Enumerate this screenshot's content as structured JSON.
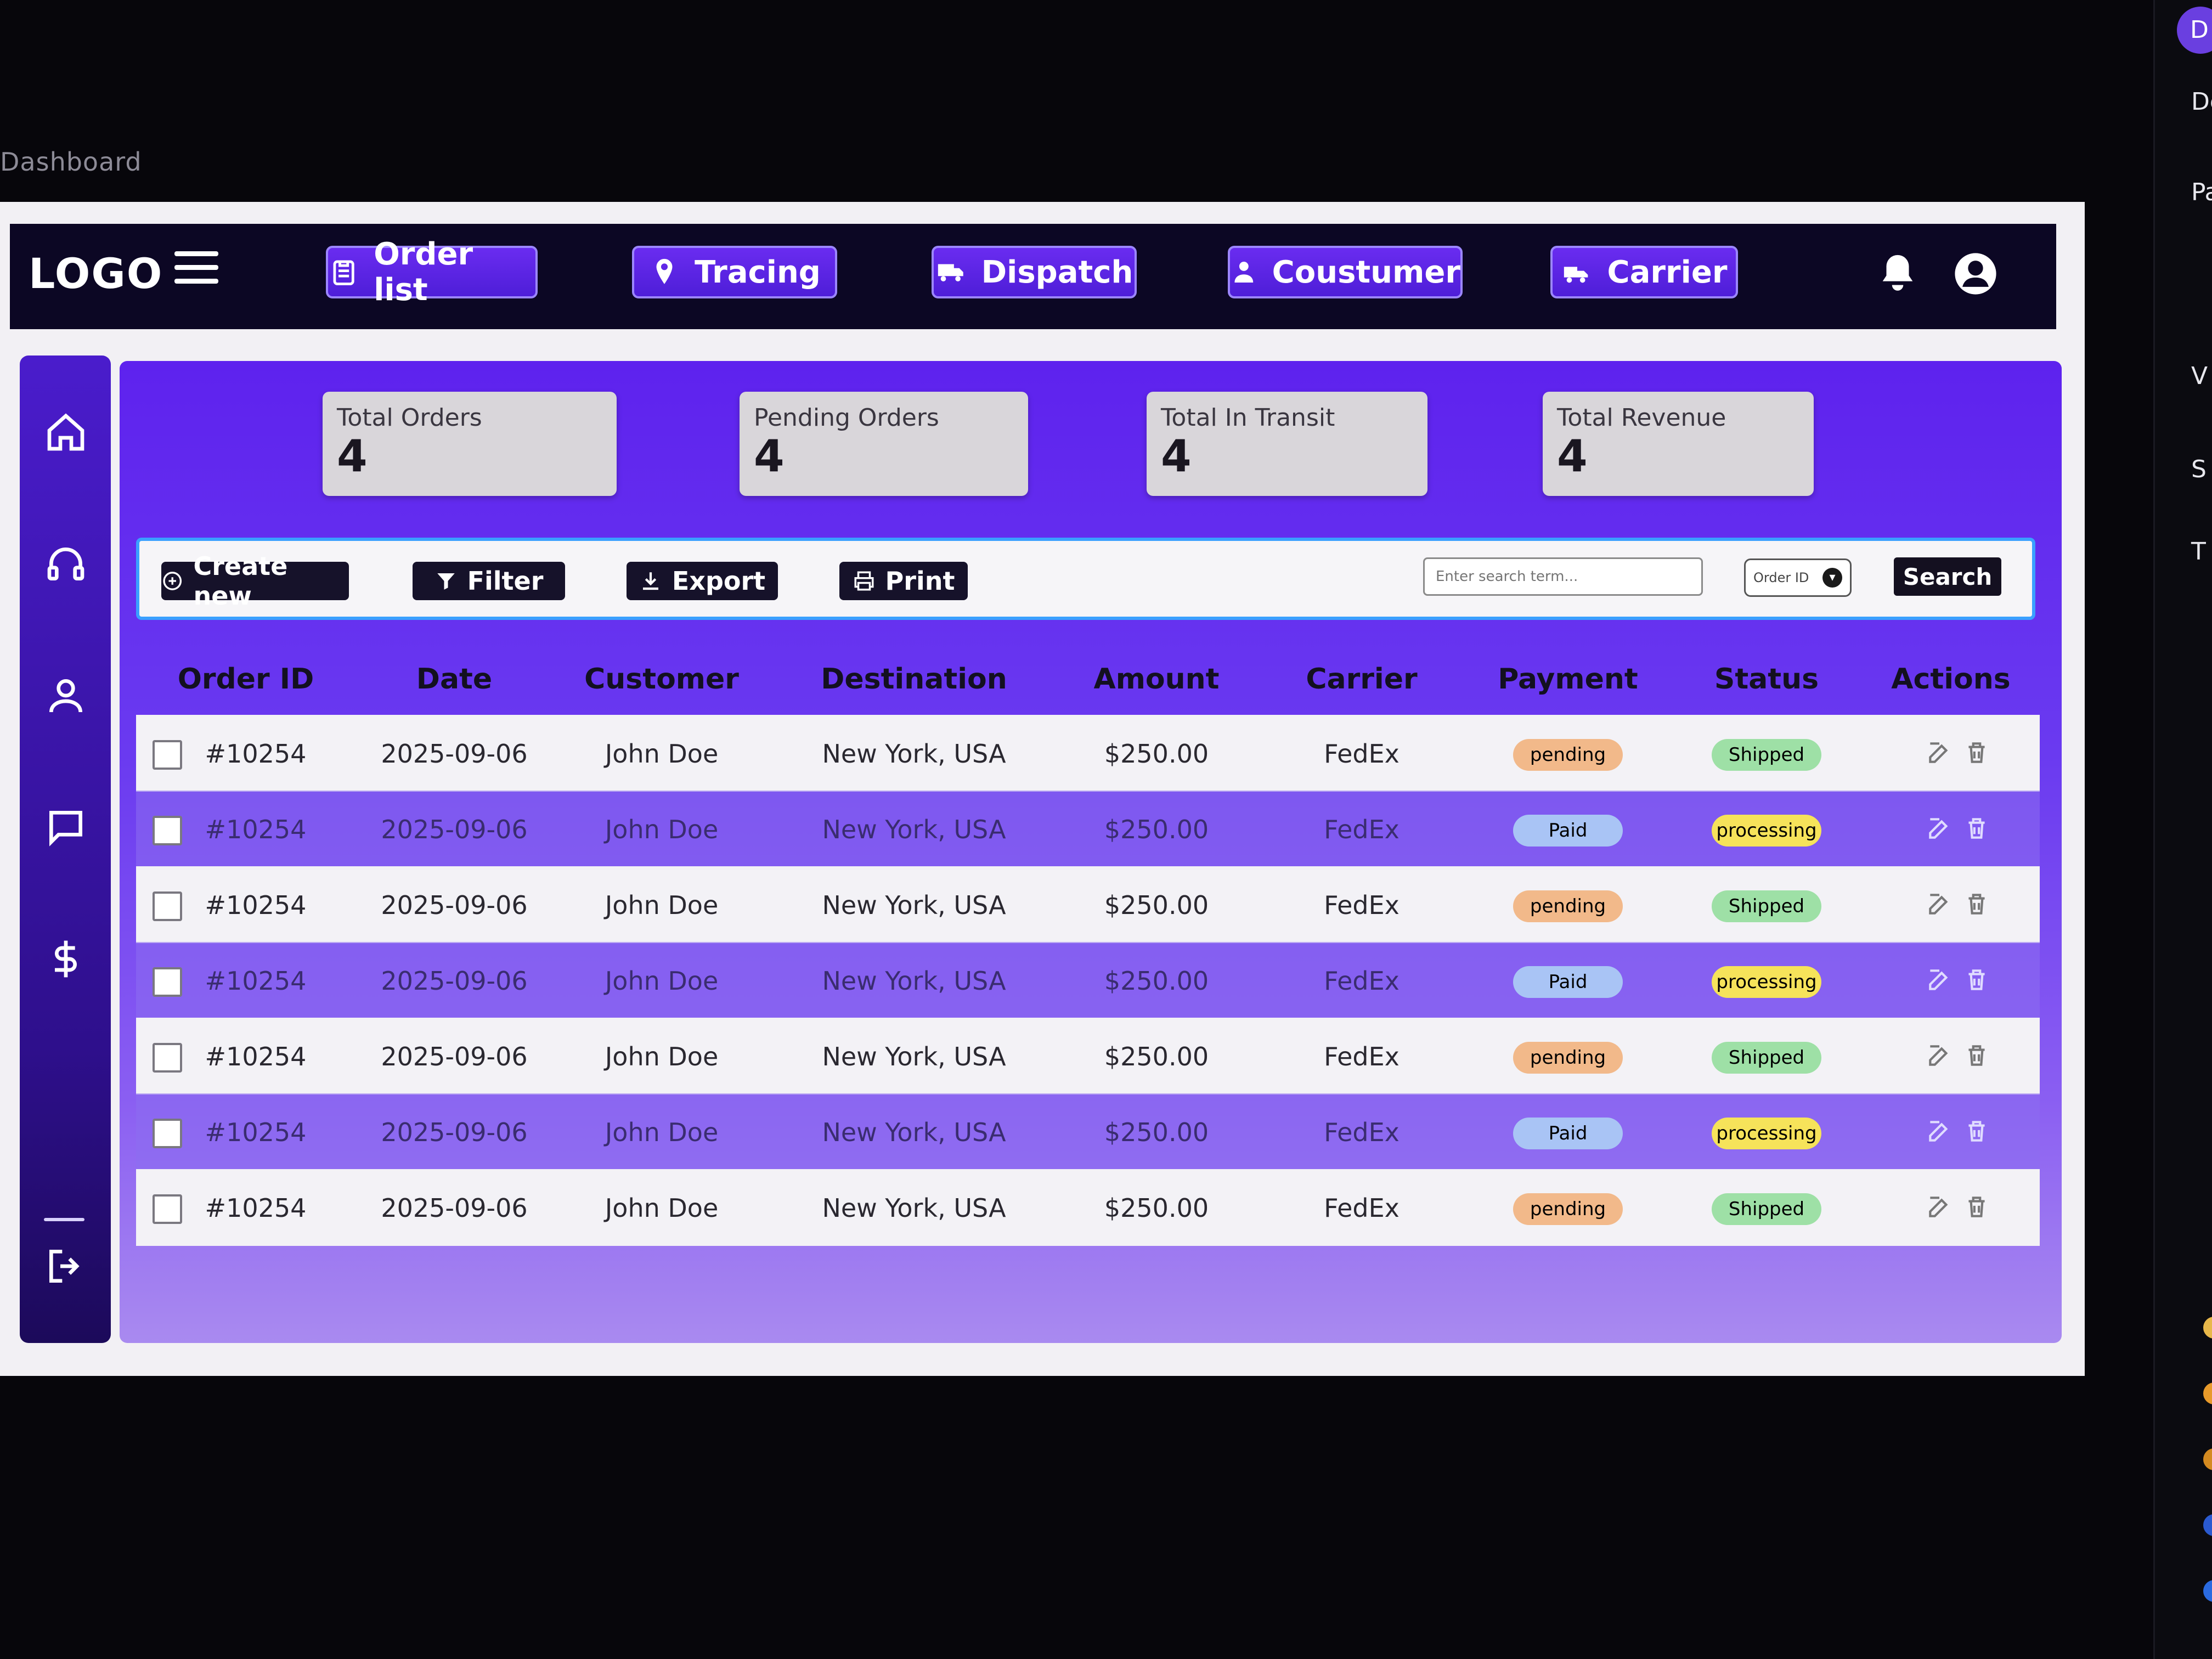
{
  "window": {
    "tab_caption": "Dashboard"
  },
  "topbar": {
    "logo": "LOGO",
    "nav": [
      {
        "label": "Order list",
        "icon": "clipboard-icon"
      },
      {
        "label": "Tracing",
        "icon": "map-pin-icon"
      },
      {
        "label": "Dispatch",
        "icon": "truck-icon"
      },
      {
        "label": "Coustumer",
        "icon": "user-icon"
      },
      {
        "label": "Carrier",
        "icon": "truck-loading-icon"
      }
    ],
    "icons": [
      "bell-icon",
      "user-avatar-icon"
    ]
  },
  "sidebar": {
    "items": [
      "home-icon",
      "headset-icon",
      "user-icon",
      "chat-icon",
      "dollar-icon"
    ],
    "logout_icon": "logout-icon"
  },
  "stats": [
    {
      "label": "Total Orders",
      "value": "4"
    },
    {
      "label": "Pending Orders",
      "value": "4"
    },
    {
      "label": "Total In Transit",
      "value": "4"
    },
    {
      "label": "Total Revenue",
      "value": "4"
    }
  ],
  "toolbar": {
    "create": "Create new",
    "filter": "Filter",
    "export": "Export",
    "print": "Print",
    "search_placeholder": "Enter search term...",
    "search_field": "Order ID",
    "search_button": "Search"
  },
  "table": {
    "columns": [
      "Order ID",
      "Date",
      "Customer",
      "Destination",
      "Amount",
      "Carrier",
      "Payment",
      "Status",
      "Actions"
    ],
    "rows": [
      {
        "id": "#10254",
        "date": "2025-09-06",
        "customer": "John Doe",
        "destination": "New York, USA",
        "amount": "$250.00",
        "carrier": "FedEx",
        "payment": "pending",
        "status": "Shipped"
      },
      {
        "id": "#10254",
        "date": "2025-09-06",
        "customer": "John Doe",
        "destination": "New York, USA",
        "amount": "$250.00",
        "carrier": "FedEx",
        "payment": "Paid",
        "status": "processing"
      },
      {
        "id": "#10254",
        "date": "2025-09-06",
        "customer": "John Doe",
        "destination": "New York, USA",
        "amount": "$250.00",
        "carrier": "FedEx",
        "payment": "pending",
        "status": "Shipped"
      },
      {
        "id": "#10254",
        "date": "2025-09-06",
        "customer": "John Doe",
        "destination": "New York, USA",
        "amount": "$250.00",
        "carrier": "FedEx",
        "payment": "Paid",
        "status": "processing"
      },
      {
        "id": "#10254",
        "date": "2025-09-06",
        "customer": "John Doe",
        "destination": "New York, USA",
        "amount": "$250.00",
        "carrier": "FedEx",
        "payment": "pending",
        "status": "Shipped"
      },
      {
        "id": "#10254",
        "date": "2025-09-06",
        "customer": "John Doe",
        "destination": "New York, USA",
        "amount": "$250.00",
        "carrier": "FedEx",
        "payment": "Paid",
        "status": "processing"
      },
      {
        "id": "#10254",
        "date": "2025-09-06",
        "customer": "John Doe",
        "destination": "New York, USA",
        "amount": "$250.00",
        "carrier": "FedEx",
        "payment": "pending",
        "status": "Shipped"
      }
    ],
    "action_icons": [
      "edit-icon",
      "trash-icon"
    ]
  },
  "colors": {
    "badge_pending": "#f2b98a",
    "badge_paid": "#a9c4f5",
    "badge_shipped": "#9ee0a6",
    "badge_processing": "#f6e35a",
    "primary": "#5e22ee"
  },
  "side_window": {
    "initial": "D",
    "fragments": [
      "De",
      "Pa",
      "V",
      "S",
      "T"
    ]
  }
}
